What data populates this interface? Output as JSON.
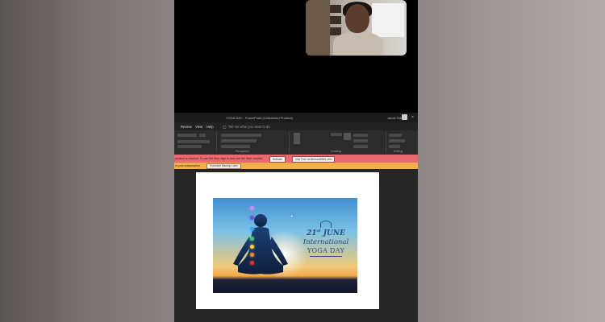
{
  "powerpoint": {
    "title": "YOGA DAY  -  PowerPoint (Unlicensed Product)",
    "user": "Jacob Sal",
    "menu": [
      "Review",
      "View",
      "Help"
    ],
    "tell_me": "Tell me what you want to do",
    "ribbon_groups": [
      "Paragraph",
      "Drawing",
      "Editing"
    ],
    "license_bar": {
      "message": "product is inactive. To use the files, sign in and use the Web version.",
      "buttons": [
        "Activate",
        "Use Free at Microsoft365.com"
      ]
    },
    "subscription_bar": {
      "message": "in your subscription.",
      "button": "Schedule Backup Later"
    }
  },
  "slide": {
    "text": {
      "date": "21",
      "date_suffix": "st",
      "month": "JUNE",
      "line2": "International",
      "line3": "YOGA DAY"
    }
  },
  "colors": {
    "license_bar": "#e86a70",
    "subscription_bar": "#f0b04c",
    "slide_text": "#2e4c86"
  }
}
